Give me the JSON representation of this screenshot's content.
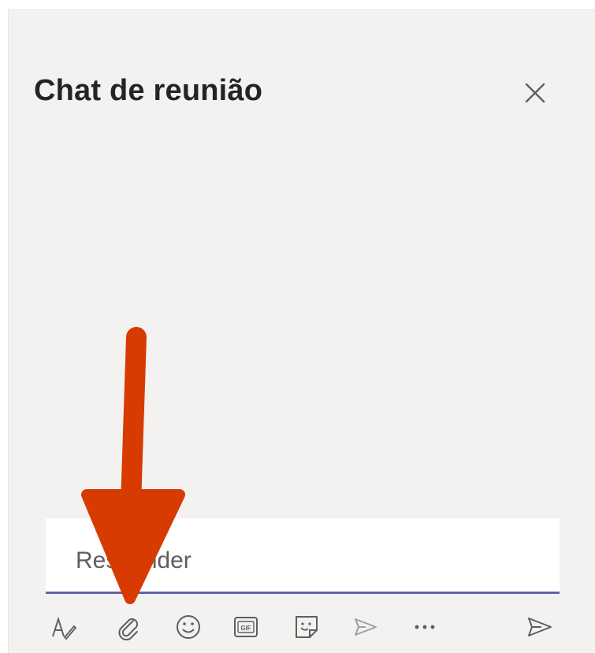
{
  "chat": {
    "title": "Chat de reunião",
    "compose_placeholder": "Responder"
  },
  "toolbar": {
    "items": [
      {
        "name": "format-icon"
      },
      {
        "name": "attach-icon"
      },
      {
        "name": "emoji-icon"
      },
      {
        "name": "gif-icon",
        "label": "GIF"
      },
      {
        "name": "sticker-icon"
      },
      {
        "name": "meet-now-icon"
      },
      {
        "name": "more-options-icon",
        "label": "•••"
      },
      {
        "name": "send-icon"
      }
    ]
  },
  "colors": {
    "panel_bg": "#f3f2f1",
    "accent": "#6264a7",
    "annotation_arrow": "#d83b01"
  }
}
